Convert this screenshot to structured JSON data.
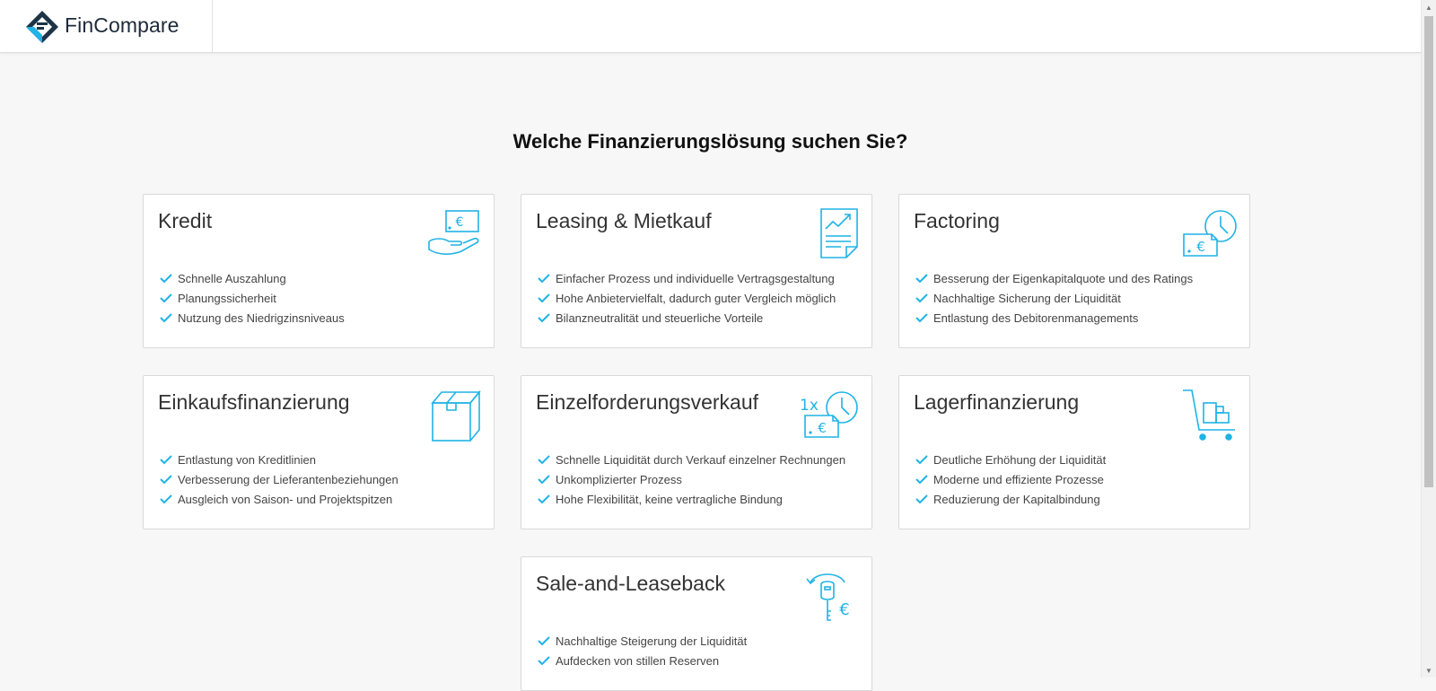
{
  "header": {
    "brand": "FinCompare"
  },
  "page_title": "Welche Finanzierungslösung suchen Sie?",
  "colors": {
    "accent": "#1fb3e6",
    "logo_dark": "#1d3447",
    "text": "#333333"
  },
  "cards": [
    {
      "title": "Kredit",
      "icon": "hand-money-icon",
      "benefits": [
        "Schnelle Auszahlung",
        "Planungssicherheit",
        "Nutzung des Niedrigzinsniveaus"
      ]
    },
    {
      "title": "Leasing & Mietkauf",
      "icon": "chart-document-icon",
      "benefits": [
        "Einfacher Prozess und individuelle Vertragsgestaltung",
        "Hohe Anbietervielfalt, dadurch guter Vergleich möglich",
        "Bilanzneutralität und steuerliche Vorteile"
      ]
    },
    {
      "title": "Factoring",
      "icon": "invoice-clock-icon",
      "benefits": [
        "Besserung der Eigenkapitalquote und des Ratings",
        "Nachhaltige Sicherung der Liquidität",
        "Entlastung des Debitorenmanagements"
      ]
    },
    {
      "title": "Einkaufsfinanzierung",
      "icon": "box-icon",
      "benefits": [
        "Entlastung von Kreditlinien",
        "Verbesserung der Lieferantenbeziehungen",
        "Ausgleich von Saison- und Projektspitzen"
      ]
    },
    {
      "title": "Einzelforderungsverkauf",
      "icon": "single-invoice-clock-icon",
      "icon_text": "1x",
      "benefits": [
        "Schnelle Liquidität durch Verkauf einzelner Rechnungen",
        "Unkomplizierter Prozess",
        "Hohe Flexibilität, keine vertragliche Bindung"
      ]
    },
    {
      "title": "Lagerfinanzierung",
      "icon": "cart-boxes-icon",
      "benefits": [
        "Deutliche Erhöhung der Liquidität",
        "Moderne und effiziente Prozesse",
        "Reduzierung der Kapitalbindung"
      ]
    },
    {
      "title": "Sale-and-Leaseback",
      "icon": "key-euro-icon",
      "benefits": [
        "Nachhaltige Steigerung der Liquidität",
        "Aufdecken von stillen Reserven"
      ]
    }
  ]
}
